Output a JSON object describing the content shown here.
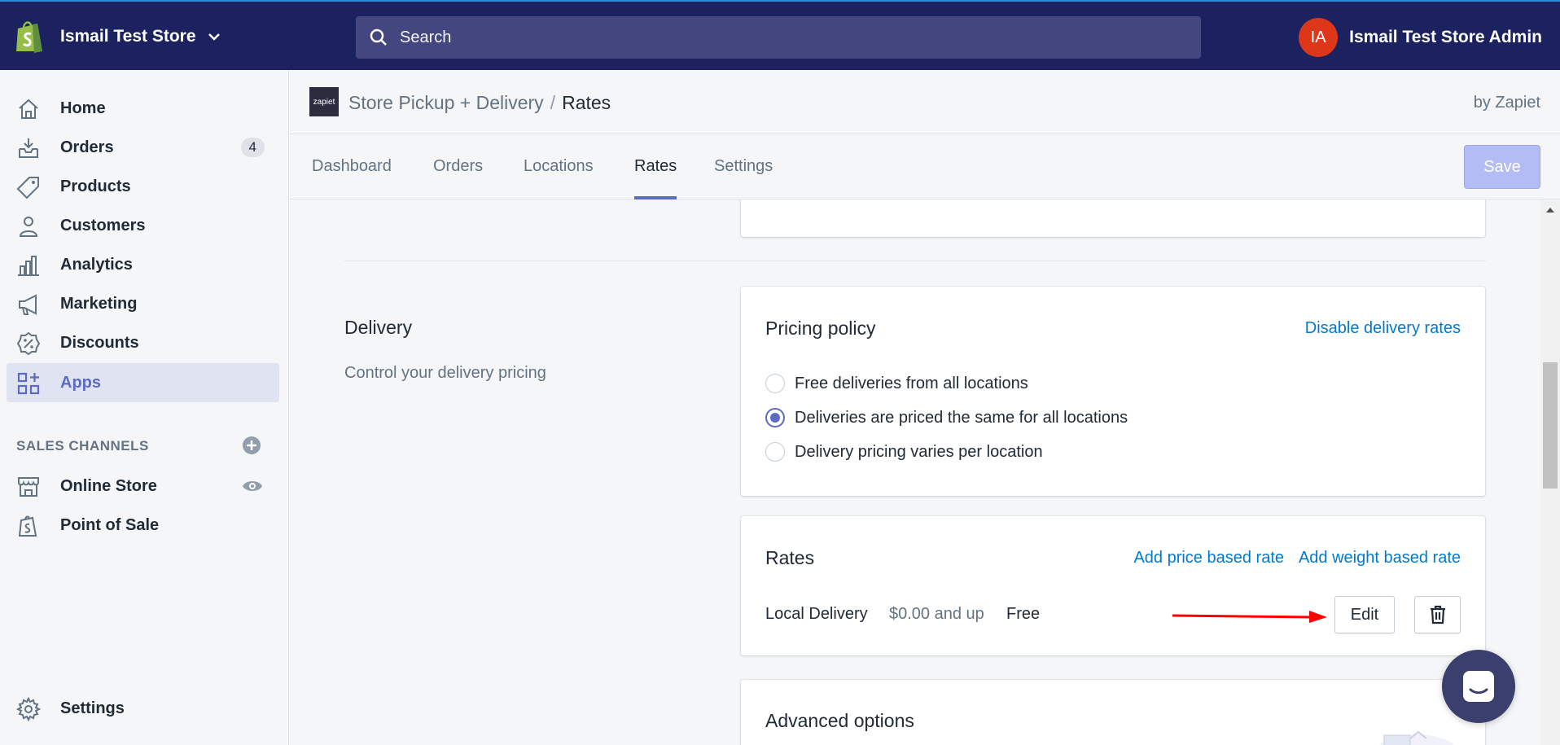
{
  "topbar": {
    "store_name": "Ismail Test Store",
    "search_placeholder": "Search",
    "user_initials": "IA",
    "user_name": "Ismail Test Store Admin"
  },
  "sidebar": {
    "items": [
      {
        "label": "Home",
        "icon": "home-icon"
      },
      {
        "label": "Orders",
        "icon": "orders-icon",
        "badge": "4"
      },
      {
        "label": "Products",
        "icon": "tag-icon"
      },
      {
        "label": "Customers",
        "icon": "person-icon"
      },
      {
        "label": "Analytics",
        "icon": "bar-chart-icon"
      },
      {
        "label": "Marketing",
        "icon": "megaphone-icon"
      },
      {
        "label": "Discounts",
        "icon": "discount-icon"
      },
      {
        "label": "Apps",
        "icon": "apps-icon",
        "active": true
      }
    ],
    "sales_channels_title": "SALES CHANNELS",
    "channels": [
      {
        "label": "Online Store",
        "icon": "store-icon"
      },
      {
        "label": "Point of Sale",
        "icon": "pos-icon"
      }
    ],
    "settings_label": "Settings"
  },
  "app_header": {
    "logo_text": "zapiet",
    "app_name": "Store Pickup + Delivery",
    "separator": "/",
    "current_page": "Rates",
    "by": "by Zapiet"
  },
  "tabs": [
    "Dashboard",
    "Orders",
    "Locations",
    "Rates",
    "Settings"
  ],
  "active_tab": "Rates",
  "save_label": "Save",
  "delivery_section": {
    "title": "Delivery",
    "description": "Control your delivery pricing"
  },
  "pricing_policy": {
    "title": "Pricing policy",
    "disable_link": "Disable delivery rates",
    "options": [
      {
        "label": "Free deliveries from all locations",
        "checked": false
      },
      {
        "label": "Deliveries are priced the same for all locations",
        "checked": true
      },
      {
        "label": "Delivery pricing varies per location",
        "checked": false
      }
    ]
  },
  "rates": {
    "title": "Rates",
    "add_price_link": "Add price based rate",
    "add_weight_link": "Add weight based rate",
    "row": {
      "name": "Local Delivery",
      "condition": "$0.00 and up",
      "price": "Free"
    },
    "edit_label": "Edit"
  },
  "advanced": {
    "title": "Advanced options"
  },
  "colors": {
    "topbar": "#1c2260",
    "accent": "#5c6ac4",
    "link": "#007ace",
    "arrow": "#ff0000",
    "avatar": "#de3618"
  }
}
